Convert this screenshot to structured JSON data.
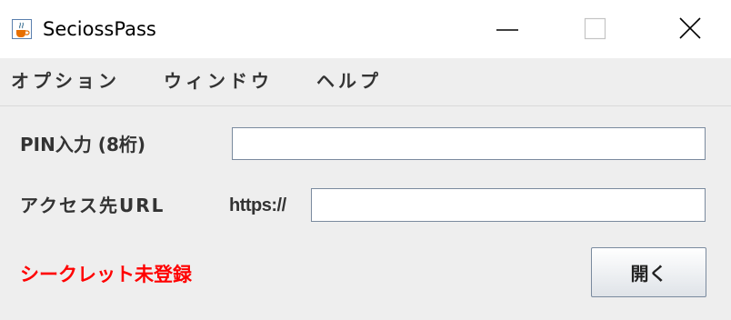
{
  "window": {
    "title": "SeciossPass"
  },
  "menu": {
    "items": [
      {
        "label": "オプション"
      },
      {
        "label": "ウィンドウ"
      },
      {
        "label": "ヘルプ"
      }
    ]
  },
  "form": {
    "pin_label": "PIN入力 (8桁)",
    "pin_value": "",
    "url_label": "アクセス先URL",
    "url_prefix": "https://",
    "url_value": ""
  },
  "status": {
    "text": "シークレット未登録",
    "color": "#ff0000"
  },
  "actions": {
    "open_label": "開く"
  },
  "icons": {
    "app": "java-cup-icon",
    "minimize": "minimize-icon",
    "maximize": "maximize-icon",
    "close": "close-icon"
  }
}
